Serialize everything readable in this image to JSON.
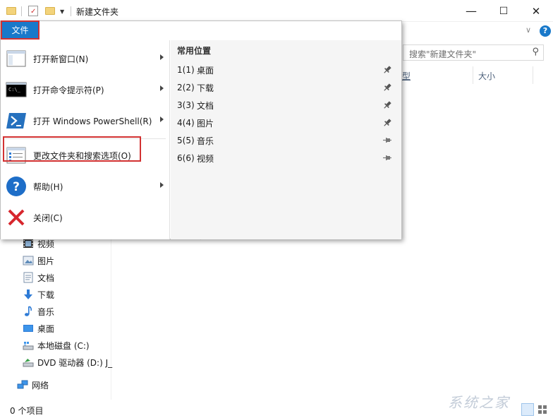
{
  "window": {
    "title": "新建文件夹",
    "controls": [
      "—",
      "☐",
      "✕"
    ]
  },
  "ribbon": {
    "file_tab": "文件"
  },
  "search": {
    "placeholder": "搜索\"新建文件夹\""
  },
  "columns": {
    "type_fragment": "型",
    "size": "大小"
  },
  "file_menu": {
    "items": [
      {
        "label": "打开新窗口(N)",
        "icon": "new-window-icon",
        "has_submenu": true
      },
      {
        "label": "打开命令提示符(P)",
        "icon": "command-prompt-icon",
        "has_submenu": true
      },
      {
        "label": "打开 Windows PowerShell(R)",
        "icon": "powershell-icon",
        "has_submenu": true
      },
      {
        "label": "更改文件夹和搜索选项(O)",
        "icon": "folder-options-icon",
        "has_submenu": false
      },
      {
        "label": "帮助(H)",
        "icon": "help-icon",
        "has_submenu": true
      },
      {
        "label": "关闭(C)",
        "icon": "close-red-x-icon",
        "has_submenu": false
      }
    ],
    "recent_title": "常用位置",
    "recent": [
      {
        "num": "1(1)",
        "name": "桌面",
        "pinned": true
      },
      {
        "num": "2(2)",
        "name": "下载",
        "pinned": true
      },
      {
        "num": "3(3)",
        "name": "文档",
        "pinned": true
      },
      {
        "num": "4(4)",
        "name": "图片",
        "pinned": true
      },
      {
        "num": "5(5)",
        "name": "音乐",
        "pinned": false
      },
      {
        "num": "6(6)",
        "name": "视频",
        "pinned": false
      }
    ]
  },
  "nav": {
    "items": [
      {
        "label": "视频",
        "icon": "video-icon"
      },
      {
        "label": "图片",
        "icon": "pictures-icon"
      },
      {
        "label": "文档",
        "icon": "documents-icon"
      },
      {
        "label": "下载",
        "icon": "downloads-icon"
      },
      {
        "label": "音乐",
        "icon": "music-icon"
      },
      {
        "label": "桌面",
        "icon": "desktop-icon"
      },
      {
        "label": "本地磁盘 (C:)",
        "icon": "local-disk-icon"
      },
      {
        "label": "DVD 驱动器 (D:) J_",
        "icon": "dvd-drive-icon"
      },
      {
        "label": "网络",
        "icon": "network-icon"
      }
    ]
  },
  "status": {
    "item_count": "0 个项目"
  },
  "watermark": "系统之家",
  "colors": {
    "accent": "#1979ca",
    "highlight": "#d23232",
    "folder": "#f3d37b"
  }
}
